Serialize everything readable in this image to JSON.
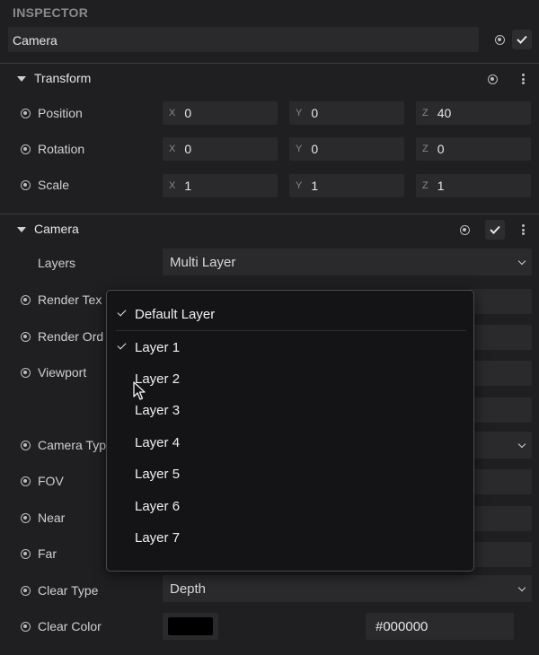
{
  "header": {
    "title": "INSPECTOR"
  },
  "node": {
    "name": "Camera"
  },
  "transform": {
    "title": "Transform",
    "position": {
      "label": "Position",
      "x": "0",
      "y": "0",
      "z": "40"
    },
    "rotation": {
      "label": "Rotation",
      "x": "0",
      "y": "0",
      "z": "0"
    },
    "scale": {
      "label": "Scale",
      "x": "1",
      "y": "1",
      "z": "1"
    },
    "axes": {
      "x": "X",
      "y": "Y",
      "z": "Z"
    }
  },
  "camera": {
    "title": "Camera",
    "layers": {
      "label": "Layers",
      "value": "Multi Layer"
    },
    "render_texture": {
      "label": "Render Tex"
    },
    "render_order": {
      "label": "Render Ord"
    },
    "viewport": {
      "label": "Viewport"
    },
    "camera_type": {
      "label": "Camera Typ"
    },
    "fov": {
      "label": "FOV"
    },
    "near": {
      "label": "Near"
    },
    "far": {
      "label": "Far"
    },
    "clear_type": {
      "label": "Clear Type",
      "value": "Depth"
    },
    "clear_color": {
      "label": "Clear Color",
      "hex": "#000000",
      "color": "#000000"
    }
  },
  "layer_popup": {
    "items": [
      {
        "label": "Default Layer",
        "checked": true
      },
      {
        "label": "Layer 1",
        "checked": true
      },
      {
        "label": "Layer 2",
        "checked": false
      },
      {
        "label": "Layer 3",
        "checked": false
      },
      {
        "label": "Layer 4",
        "checked": false
      },
      {
        "label": "Layer 5",
        "checked": false
      },
      {
        "label": "Layer 6",
        "checked": false
      },
      {
        "label": "Layer 7",
        "checked": false
      }
    ]
  },
  "icons": {
    "toggle": "radio-dot-icon",
    "check": "checkmark-icon",
    "menu": "kebab-menu-icon",
    "collapse": "caret-down-icon",
    "dropdown": "chevron-down-icon",
    "cursor": "mouse-pointer-icon"
  }
}
